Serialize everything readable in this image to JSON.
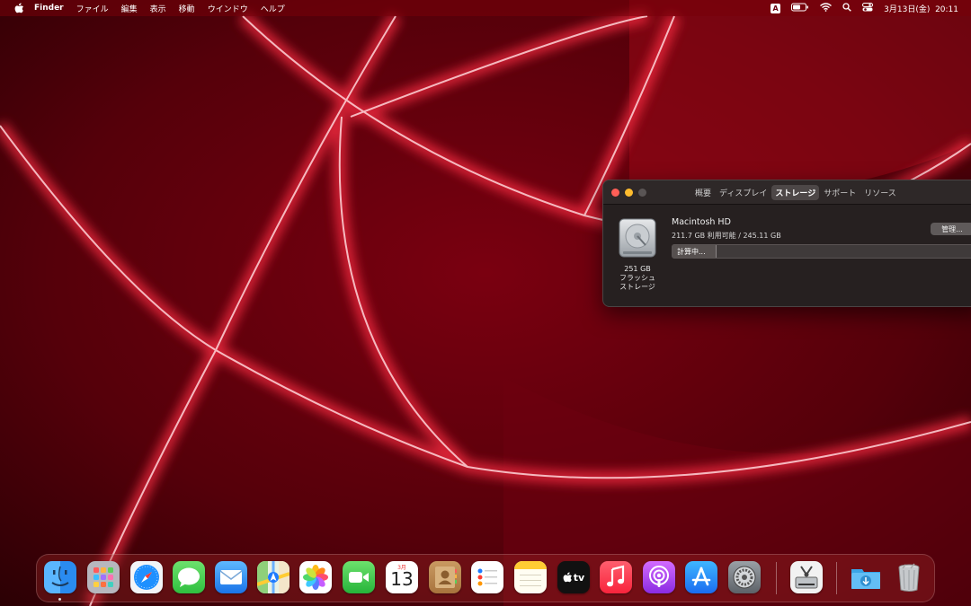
{
  "menubar": {
    "app_name": "Finder",
    "menus": [
      "ファイル",
      "編集",
      "表示",
      "移動",
      "ウインドウ",
      "ヘルプ"
    ],
    "input_source": "A",
    "datetime": "3月13日(金)  20:11"
  },
  "about_window": {
    "tabs": [
      "概要",
      "ディスプレイ",
      "ストレージ",
      "サポート",
      "リソース"
    ],
    "active_tab": "ストレージ",
    "disk": {
      "capacity": "251 GB",
      "type_line1": "フラッシュ",
      "type_line2": "ストレージ",
      "name": "Macintosh HD",
      "availability": "211.7 GB 利用可能 / 245.11 GB",
      "status": "計算中...",
      "progress_fraction": 0.14
    },
    "manage_label": "管理..."
  },
  "dock": {
    "apps": [
      "finder-icon",
      "launchpad-icon",
      "safari-icon",
      "messages-icon",
      "mail-icon",
      "maps-icon",
      "photos-icon",
      "facetime-icon",
      "calendar-icon",
      "contacts-icon",
      "reminders-icon",
      "notes-icon",
      "apple-tv-icon",
      "music-icon",
      "podcasts-icon",
      "app-store-icon",
      "system-preferences-icon",
      "disk-utility-icon",
      "downloads-folder-icon",
      "trash-icon"
    ],
    "calendar_month": "3月",
    "calendar_day": "13",
    "tv_label": "tv"
  },
  "colors": {
    "wallpaper_base": "#4a0007",
    "wallpaper_glow": "#ff3b4d",
    "window_bg": "#262020",
    "accent_close": "#ff5f57",
    "accent_minimize": "#febc2e"
  }
}
